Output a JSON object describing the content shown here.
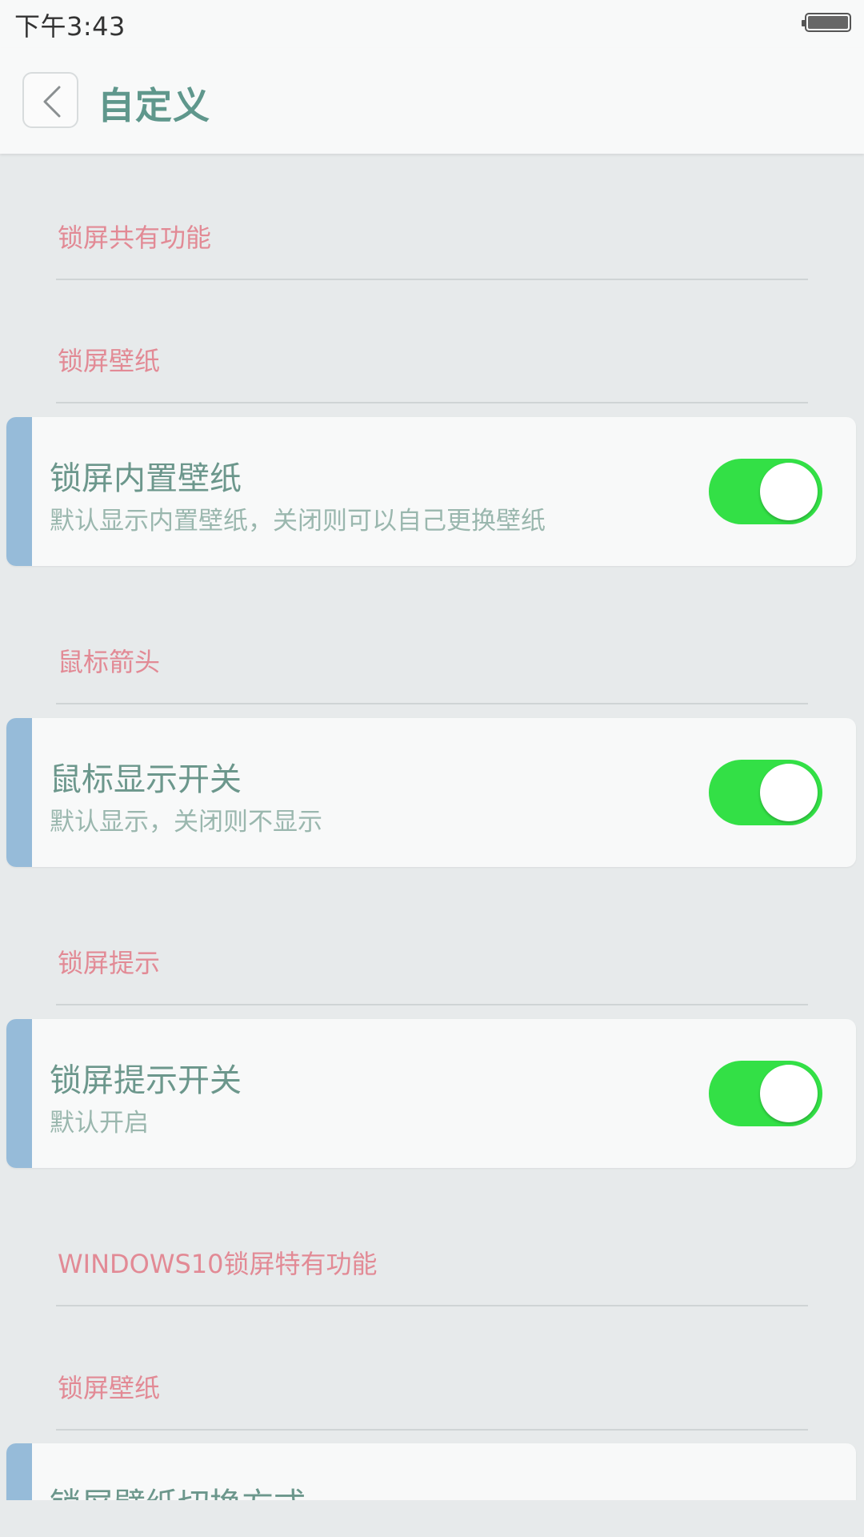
{
  "status_bar": {
    "time": "下午3:43"
  },
  "header": {
    "title": "自定义",
    "back_icon": "chevron-left-icon"
  },
  "colors": {
    "section_title": "#e28a95",
    "card_title": "#6c978c",
    "card_desc": "#9ab7ae",
    "accent_bar": "#96bbd9",
    "toggle_on": "#33e046",
    "header_title": "#5f978c"
  },
  "sections": {
    "common": "锁屏共有功能",
    "wallpaper": "锁屏壁纸",
    "mouse": "鼠标箭头",
    "hint": "锁屏提示",
    "win10": "WINDOWS10锁屏特有功能",
    "win10_wallpaper": "锁屏壁纸"
  },
  "settings": {
    "builtin_wallpaper": {
      "title": "锁屏内置壁纸",
      "desc": "默认显示内置壁纸，关闭则可以自己更换壁纸",
      "enabled": true
    },
    "mouse_display": {
      "title": "鼠标显示开关",
      "desc": "默认显示，关闭则不显示",
      "enabled": true
    },
    "lock_hint": {
      "title": "锁屏提示开关",
      "desc": "默认开启",
      "enabled": true
    },
    "wallpaper_switch_mode": {
      "title": "锁屏壁纸切换方式"
    }
  }
}
